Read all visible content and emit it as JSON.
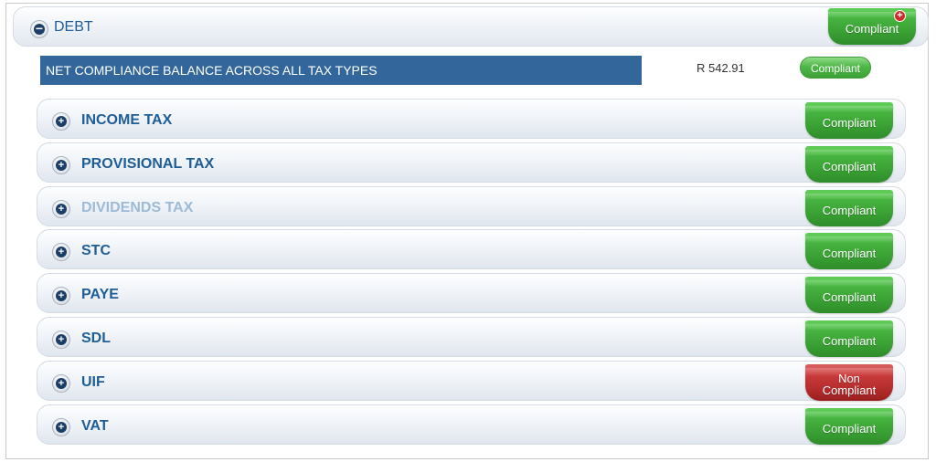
{
  "debt": {
    "title": "DEBT",
    "toggle_icon": "minus",
    "status": "Compliant",
    "alert_icon": "+"
  },
  "net_balance": {
    "label": "NET COMPLIANCE BALANCE ACROSS ALL TAX TYPES",
    "amount": "R  542.91",
    "status": "Compliant"
  },
  "tax_types": [
    {
      "label": "INCOME TAX",
      "status": "Compliant",
      "status_type": "green",
      "muted": false
    },
    {
      "label": "PROVISIONAL TAX",
      "status": "Compliant",
      "status_type": "green",
      "muted": false
    },
    {
      "label": "DIVIDENDS TAX",
      "status": "Compliant",
      "status_type": "green",
      "muted": true
    },
    {
      "label": "STC",
      "status": "Compliant",
      "status_type": "green",
      "muted": false
    },
    {
      "label": "PAYE",
      "status": "Compliant",
      "status_type": "green",
      "muted": false
    },
    {
      "label": "SDL",
      "status": "Compliant",
      "status_type": "green",
      "muted": false
    },
    {
      "label": "UIF",
      "status": "Non Compliant",
      "status_type": "red",
      "muted": false
    },
    {
      "label": "VAT",
      "status": "Compliant",
      "status_type": "green",
      "muted": false
    }
  ],
  "expand_icon": "+",
  "colors": {
    "compliant": "#3aa134",
    "non_compliant": "#b12a2a",
    "header_bar": "#33679b",
    "label_text": "#1f5d96"
  }
}
